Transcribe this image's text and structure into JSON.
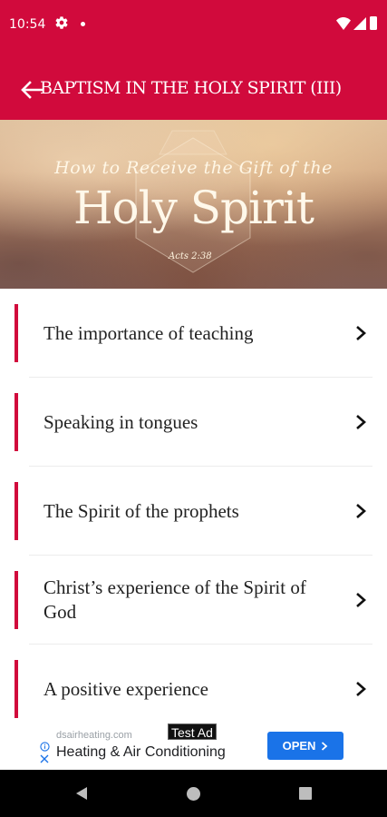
{
  "status_bar": {
    "time": "10:54",
    "icons": [
      "gear-icon",
      "notification-dot",
      "wifi-icon",
      "signal-icon",
      "battery-icon"
    ]
  },
  "app_bar": {
    "title": "BAPTISM IN THE HOLY SPIRIT (III)",
    "back_icon": "arrow-left-icon",
    "color": "#d10a3c"
  },
  "banner": {
    "line1": "How to Receive the Gift of the",
    "line2": "Holy Spirit",
    "reference": "Acts 2:38"
  },
  "items": [
    {
      "label": "The importance of teaching"
    },
    {
      "label": "Speaking in tongues"
    },
    {
      "label": "The Spirit of the prophets"
    },
    {
      "label": "Christ’s experience of the Spirit of God"
    },
    {
      "label": "A positive experience"
    }
  ],
  "ad": {
    "tag": "Test Ad",
    "domain": "dsairheating.com",
    "headline": "Heating & Air Conditioning",
    "cta": "OPEN",
    "cta_color": "#1a73e8"
  },
  "nav": {
    "icons": [
      "back-triangle-icon",
      "home-circle-icon",
      "recents-square-icon"
    ]
  }
}
